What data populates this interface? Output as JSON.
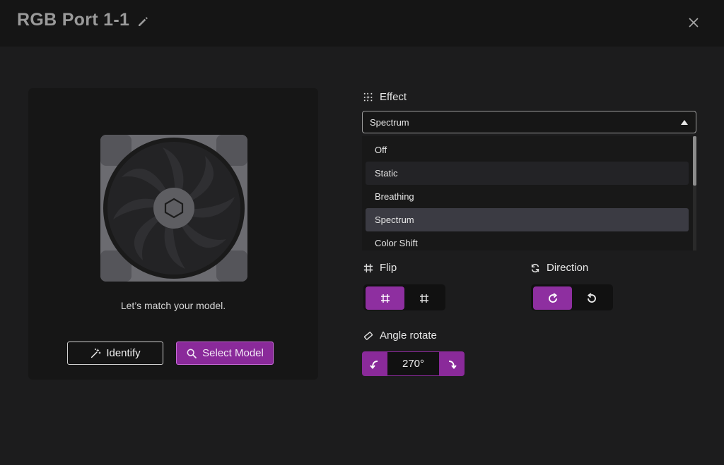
{
  "window": {
    "title": "RGB Port 1-1"
  },
  "model": {
    "prompt": "Let’s match your model.",
    "identify_label": "Identify",
    "select_model_label": "Select Model"
  },
  "effect": {
    "label": "Effect",
    "selected": "Spectrum",
    "options": [
      "Off",
      "Static",
      "Breathing",
      "Spectrum",
      "Color Shift"
    ],
    "hovered_option": "Static"
  },
  "flip": {
    "label": "Flip",
    "active_index": 0
  },
  "direction": {
    "label": "Direction",
    "active": "clockwise"
  },
  "angle": {
    "label": "Angle rotate",
    "value": "270°"
  },
  "colors": {
    "accent": "#8a2a9a",
    "background": "#1c1c1d",
    "titlebar": "#151515"
  }
}
